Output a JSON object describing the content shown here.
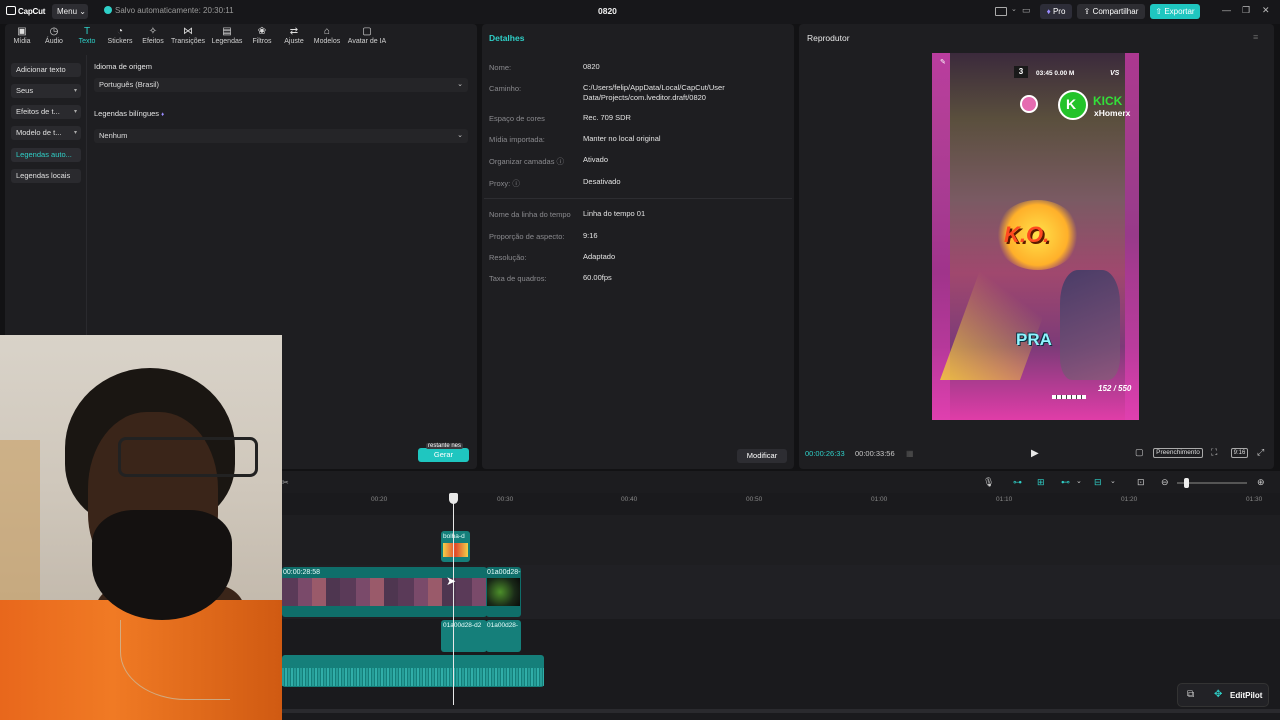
{
  "titlebar": {
    "logo": "CapCut",
    "menu": "Menu",
    "save_status": "Salvo automaticamente: 20:30:11",
    "project_name": "0820",
    "pro": "Pro",
    "share": "Compartilhar",
    "export": "Exportar"
  },
  "tool_tabs": [
    {
      "label": "Mídia",
      "icon": "media-icon"
    },
    {
      "label": "Áudio",
      "icon": "audio-icon"
    },
    {
      "label": "Texto",
      "icon": "text-icon"
    },
    {
      "label": "Stickers",
      "icon": "stickers-icon"
    },
    {
      "label": "Efeitos",
      "icon": "effects-icon"
    },
    {
      "label": "Transições",
      "icon": "transitions-icon"
    },
    {
      "label": "Legendas",
      "icon": "captions-icon"
    },
    {
      "label": "Filtros",
      "icon": "filters-icon"
    },
    {
      "label": "Ajuste",
      "icon": "adjust-icon"
    },
    {
      "label": "Modelos",
      "icon": "templates-icon"
    },
    {
      "label": "Avatar de IA",
      "icon": "ai-avatar-icon"
    }
  ],
  "left_nav": [
    {
      "label": "Adicionar texto"
    },
    {
      "label": "Seus"
    },
    {
      "label": "Efeitos de t..."
    },
    {
      "label": "Modelo de t..."
    },
    {
      "label": "Legendas auto..."
    },
    {
      "label": "Legendas locais"
    }
  ],
  "captions_panel": {
    "source_lang_label": "Idioma de origem",
    "source_lang_value": "Português (Brasil)",
    "bilingual_label": "Legendas bilíngues",
    "bilingual_value": "Nenhum",
    "generate": "Gerar",
    "generate_hint": "restante nes"
  },
  "details": {
    "title": "Detalhes",
    "rows": [
      {
        "key": "Nome:",
        "value": "0820"
      },
      {
        "key": "Caminho:",
        "value": "C:/Users/felip/AppData/Local/CapCut/User Data/Projects/com.lveditor.draft/0820"
      },
      {
        "key": "Espaço de cores",
        "value": "Rec. 709 SDR"
      },
      {
        "key": "Mídia importada:",
        "value": "Manter no local original"
      },
      {
        "key": "Organizar camadas",
        "value": "Ativado"
      },
      {
        "key": "Proxy:",
        "value": "Desativado"
      },
      {
        "key": "Nome da linha do tempo",
        "value": "Linha do tempo 01"
      },
      {
        "key": "Proporção de aspecto:",
        "value": "9:16"
      },
      {
        "key": "Resolução:",
        "value": "Adaptado"
      },
      {
        "key": "Taxa de quadros:",
        "value": "60.00fps"
      }
    ],
    "modify": "Modificar"
  },
  "player": {
    "title": "Reprodutor",
    "current_time": "00:00:26:33",
    "total_time": "00:00:33:56",
    "fill_mode": "Preenchimento",
    "ratio": "9:16",
    "video_overlay": {
      "round": "3",
      "timer": "03:45  0.00 M",
      "vs": "VS",
      "kick": "KICK",
      "user": "xHomerx",
      "ko": "K.O.",
      "pra": "PRA",
      "hp": "152 / 550"
    }
  },
  "timeline": {
    "ruler_ticks": [
      "00:20",
      "00:30",
      "00:40",
      "00:50",
      "01:00",
      "01:10",
      "01:20",
      "01:30"
    ],
    "clips": {
      "sticker": "bolha-d",
      "main": "00:00:28:58",
      "second": "01a00d28-",
      "audio1": "01a00d28-d2",
      "audio2": "01a00d28-"
    }
  },
  "editpilot": "EditPilot",
  "colors": {
    "accent": "#1fc6c0",
    "accent_text": "#2fd0c8",
    "panel": "#1e1e21",
    "background": "#121214"
  }
}
